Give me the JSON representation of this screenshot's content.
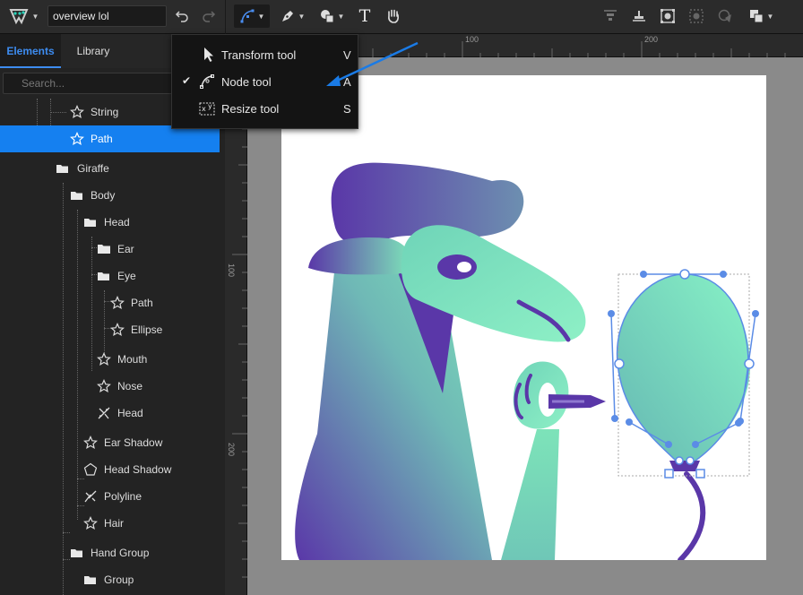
{
  "toolbar": {
    "document_name": "overview lol",
    "text_tool_glyph": "T",
    "icons": [
      "logo-icon",
      "undo-icon",
      "redo-icon",
      "node-tool-icon",
      "pen-tool-icon",
      "shapes-icon",
      "text-tool-icon",
      "hand-tool-icon",
      "align-top-icon",
      "align-middle-icon",
      "group-icon",
      "ungroup-icon",
      "boolean-icon",
      "arrange-icon"
    ]
  },
  "panel": {
    "tabs": [
      {
        "label": "Elements",
        "active": true
      },
      {
        "label": "Library",
        "active": false
      }
    ],
    "search_placeholder": "Search...",
    "tree": [
      {
        "label": "String",
        "type": "shape"
      },
      {
        "label": "Path",
        "type": "shape",
        "selected": true
      },
      {
        "label": "Giraffe",
        "type": "folder"
      },
      {
        "label": "Body",
        "type": "folder"
      },
      {
        "label": "Head",
        "type": "folder"
      },
      {
        "label": "Ear",
        "type": "folder-closed"
      },
      {
        "label": "Eye",
        "type": "folder"
      },
      {
        "label": "Path",
        "type": "shape"
      },
      {
        "label": "Ellipse",
        "type": "shape"
      },
      {
        "label": "Mouth",
        "type": "shape"
      },
      {
        "label": "Nose",
        "type": "shape"
      },
      {
        "label": "Head",
        "type": "boolean"
      },
      {
        "label": "Ear Shadow",
        "type": "shape"
      },
      {
        "label": "Head Shadow",
        "type": "polygon"
      },
      {
        "label": "Polyline",
        "type": "polyline"
      },
      {
        "label": "Hair",
        "type": "shape"
      },
      {
        "label": "Hand Group",
        "type": "folder"
      },
      {
        "label": "Group",
        "type": "folder"
      }
    ]
  },
  "ruler": {
    "top_labels": [
      "100",
      "200"
    ],
    "left_labels": [
      "100",
      "200"
    ]
  },
  "menu": {
    "items": [
      {
        "label": "Transform tool",
        "shortcut": "V",
        "checked": false,
        "icon": "cursor-icon"
      },
      {
        "label": "Node tool",
        "shortcut": "A",
        "checked": true,
        "check_glyph": "✔",
        "icon": "node-tool-icon"
      },
      {
        "label": "Resize tool",
        "shortcut": "S",
        "checked": false,
        "icon": "resize-tool-icon"
      }
    ]
  },
  "colors": {
    "accent": "#1580f0",
    "purple": "#5b3aa8",
    "teal": "#7de3b9",
    "selection": "#5b8ce6",
    "annotation_arrow": "#1a7be6"
  }
}
